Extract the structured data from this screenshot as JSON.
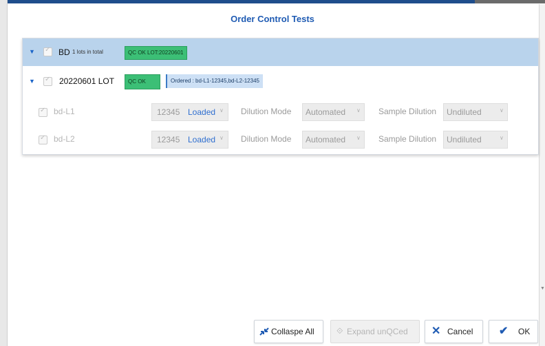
{
  "dialog": {
    "title": "Order Control Tests"
  },
  "group": {
    "name": "BD",
    "lots_text": "1 lots in total",
    "status": "QC OK LOT:20220601"
  },
  "lot": {
    "name": "20220601 LOT",
    "status": "QC OK",
    "ordered": "Ordered : bd-L1-12345,bd-L2-12345"
  },
  "tests": [
    {
      "name": "bd-L1",
      "lot_number": "12345",
      "state": "Loaded",
      "dilution_mode_label": "Dilution Mode",
      "dilution_mode": "Automated",
      "sample_dilution_label": "Sample Dilution",
      "sample_dilution": "Undiluted"
    },
    {
      "name": "bd-L2",
      "lot_number": "12345",
      "state": "Loaded",
      "dilution_mode_label": "Dilution Mode",
      "dilution_mode": "Automated",
      "sample_dilution_label": "Sample Dilution",
      "sample_dilution": "Undiluted"
    }
  ],
  "buttons": {
    "collapse_all": "Collaspe All",
    "expand_unqced": "Expand unQCed",
    "cancel": "Cancel",
    "ok": "OK"
  },
  "colors": {
    "accent": "#1f5bb3",
    "qc_ok": "#3cbf76",
    "group_row": "#b9d3ec",
    "ordered_badge": "#cde0f5"
  }
}
